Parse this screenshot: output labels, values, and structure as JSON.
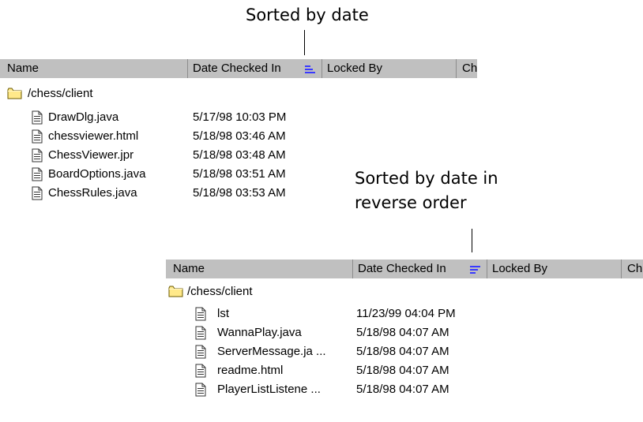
{
  "annotations": {
    "top": "Sorted by date",
    "bottom_line1": "Sorted by date in",
    "bottom_line2": "reverse order"
  },
  "icons": {
    "folder": "folder-icon",
    "file": "file-icon",
    "sort_ascending": "sort-ascending-icon",
    "sort_descending": "sort-descending-icon"
  },
  "colors": {
    "header_bg": "#c0c0c0",
    "sort_icon": "#3a3aff",
    "folder": "#ffe98a"
  },
  "table_top": {
    "columns": [
      "Name",
      "Date Checked In",
      "Locked By",
      "Ch"
    ],
    "sort": "ascending",
    "folder": "/chess/client",
    "rows": [
      {
        "name": "DrawDlg.java",
        "date": "5/17/98 10:03 PM"
      },
      {
        "name": "chessviewer.html",
        "date": "5/18/98 03:46 AM"
      },
      {
        "name": "ChessViewer.jpr",
        "date": "5/18/98 03:48 AM"
      },
      {
        "name": "BoardOptions.java",
        "date": "5/18/98 03:51 AM"
      },
      {
        "name": "ChessRules.java",
        "date": "5/18/98 03:53 AM"
      }
    ]
  },
  "table_bottom": {
    "columns": [
      "Name",
      "Date Checked In",
      "Locked By",
      "Ch"
    ],
    "sort": "descending",
    "folder": "/chess/client",
    "rows": [
      {
        "name": "lst",
        "date": "11/23/99 04:04 PM"
      },
      {
        "name": "WannaPlay.java",
        "date": "5/18/98 04:07 AM"
      },
      {
        "name": "ServerMessage.ja ...",
        "date": "5/18/98 04:07 AM"
      },
      {
        "name": "readme.html",
        "date": "5/18/98 04:07 AM"
      },
      {
        "name": "PlayerListListene ...",
        "date": "5/18/98 04:07 AM"
      }
    ]
  }
}
